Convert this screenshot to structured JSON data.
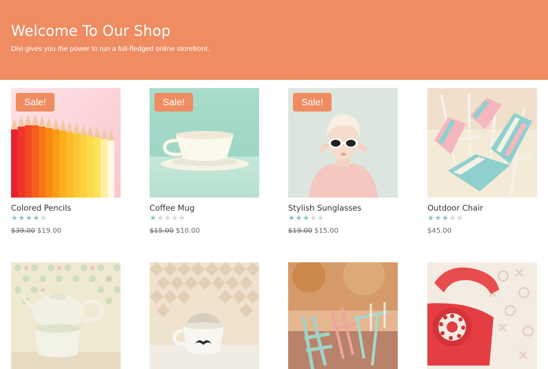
{
  "header": {
    "title": "Welcome To Our Shop",
    "subtitle": "Divi gives you the power to run a full-fledged online storefront."
  },
  "colors": {
    "accent": "#ef8c62",
    "star_filled": "#8ec2c7",
    "star_empty": "#d6d6d6"
  },
  "products": [
    {
      "name": "Colored Pencils",
      "sale_label": "Sale!",
      "on_sale": true,
      "rating": 4,
      "old_price": "$39.00",
      "price": "$19.00",
      "image": "colored-pencils"
    },
    {
      "name": "Coffee Mug",
      "sale_label": "Sale!",
      "on_sale": true,
      "rating": 1,
      "old_price": "$15.00",
      "price": "$10.00",
      "image": "coffee-mug"
    },
    {
      "name": "Stylish Sunglasses",
      "sale_label": "Sale!",
      "on_sale": true,
      "rating": 3,
      "old_price": "$19.00",
      "price": "$15.00",
      "image": "woman-sunglasses"
    },
    {
      "name": "Outdoor Chair",
      "sale_label": "",
      "on_sale": false,
      "rating": 3,
      "old_price": "",
      "price": "$45.00",
      "image": "outdoor-chairs"
    },
    {
      "name": "",
      "image": "teapot-cup"
    },
    {
      "name": "",
      "image": "mustache-mug"
    },
    {
      "name": "",
      "image": "cafe-chairs"
    },
    {
      "name": "",
      "image": "red-telephone"
    }
  ]
}
